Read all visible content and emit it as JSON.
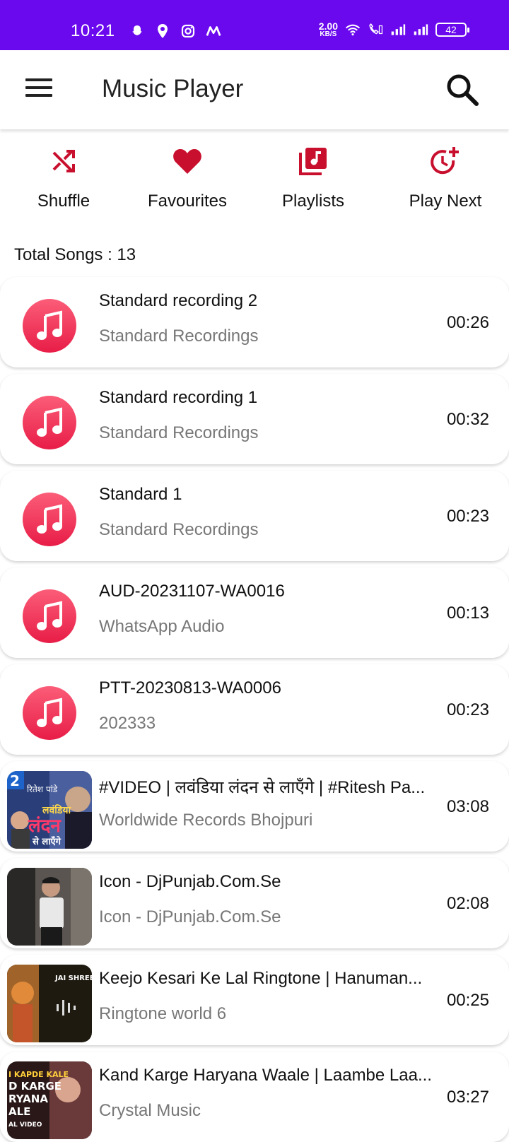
{
  "status_bar": {
    "time": "10:21",
    "net_speed_value": "2.00",
    "net_speed_unit": "KB/S",
    "battery": "42",
    "icons": [
      "snapchat-icon",
      "location-icon",
      "instagram-icon",
      "m-logo-icon",
      "wifi-icon",
      "call-icon",
      "signal-icon",
      "signal-icon"
    ]
  },
  "app_bar": {
    "title": "Music Player",
    "menu_icon": "hamburger-menu-icon",
    "search_icon": "search-icon"
  },
  "quick_actions": [
    {
      "label": "Shuffle",
      "icon": "shuffle-icon"
    },
    {
      "label": "Favourites",
      "icon": "heart-icon"
    },
    {
      "label": "Playlists",
      "icon": "playlist-icon"
    },
    {
      "label": "Play Next",
      "icon": "play-next-icon"
    }
  ],
  "total_songs": "Total Songs : 13",
  "songs": [
    {
      "title": "Standard recording 2",
      "artist": "Standard Recordings",
      "duration": "00:26",
      "art": "music-note-icon"
    },
    {
      "title": "Standard recording 1",
      "artist": "Standard Recordings",
      "duration": "00:32",
      "art": "music-note-icon"
    },
    {
      "title": "Standard 1",
      "artist": "Standard Recordings",
      "duration": "00:23",
      "art": "music-note-icon"
    },
    {
      "title": "AUD-20231107-WA0016",
      "artist": "WhatsApp Audio",
      "duration": "00:13",
      "art": "music-note-icon"
    },
    {
      "title": "PTT-20230813-WA0006",
      "artist": "202333",
      "duration": "00:23",
      "art": "music-note-icon"
    },
    {
      "title": "#VIDEO |  लवंडिया लंदन से लाएँगे | #Ritesh Pa...",
      "artist": "Worldwide Records Bhojpuri",
      "duration": "03:08",
      "art": "thumbnail"
    },
    {
      "title": "Icon - DjPunjab.Com.Se",
      "artist": "Icon - DjPunjab.Com.Se",
      "duration": "02:08",
      "art": "thumbnail"
    },
    {
      "title": "Keejo Kesari Ke Lal Ringtone | Hanuman...",
      "artist": "Ringtone world 6",
      "duration": "00:25",
      "art": "thumbnail"
    },
    {
      "title": "Kand Karge Haryana Waale | Laambe Laa...",
      "artist": "Crystal Music",
      "duration": "03:27",
      "art": "thumbnail"
    }
  ],
  "thumbnail_text": {
    "song6": [
      "2",
      "रितेश पांडे",
      "लवंडिया",
      "लंदन",
      "से लाएँगे"
    ],
    "song8": [
      "JAI SHREE"
    ],
    "song9": [
      "I KAPDE KALE",
      "D KARGE",
      "RYANA",
      "ALE",
      "AL VIDEO"
    ]
  },
  "colors": {
    "status_bar": "#6a08ee",
    "accent_red": "#c8102e",
    "note_gradient_top": "#fb5d78",
    "note_gradient_bottom": "#e81d47"
  }
}
